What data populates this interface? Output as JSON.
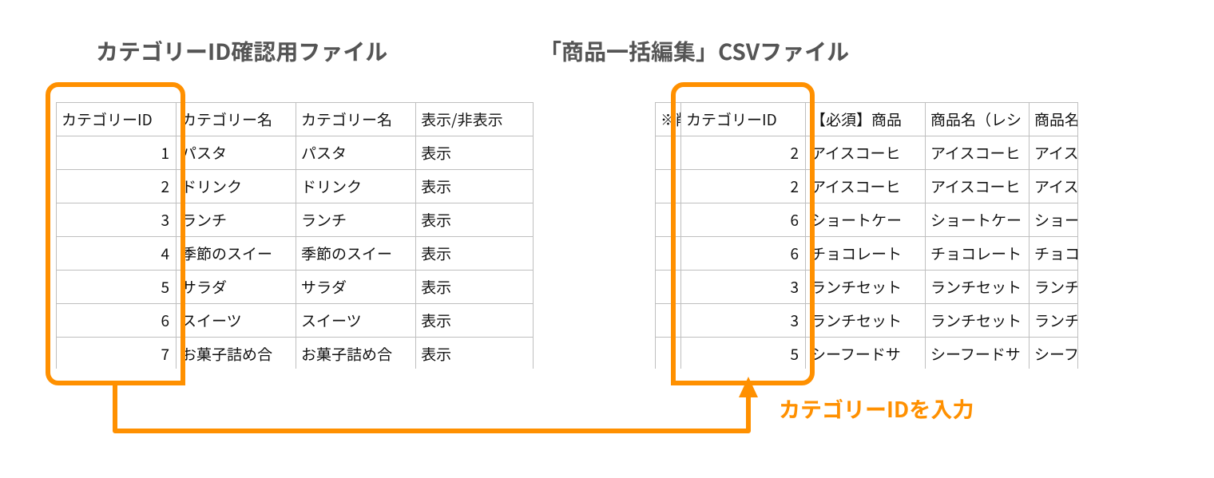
{
  "left_title": "カテゴリーID確認用ファイル",
  "right_title": "「商品一括編集」CSVファイル",
  "callout": "カテゴリーIDを入力",
  "left_table": {
    "headers": [
      "カテゴリーID",
      "カテゴリー名",
      "カテゴリー名",
      "表示/非表示"
    ],
    "rows": [
      {
        "id": "1",
        "name1": "パスタ",
        "name2": "パスタ",
        "vis": "表示"
      },
      {
        "id": "2",
        "name1": "ドリンク",
        "name2": "ドリンク",
        "vis": "表示"
      },
      {
        "id": "3",
        "name1": "ランチ",
        "name2": "ランチ",
        "vis": "表示"
      },
      {
        "id": "4",
        "name1": "季節のスイー",
        "name2": "季節のスイー",
        "vis": "表示"
      },
      {
        "id": "5",
        "name1": "サラダ",
        "name2": "サラダ",
        "vis": "表示"
      },
      {
        "id": "6",
        "name1": "スイーツ",
        "name2": "スイーツ",
        "vis": "表示"
      },
      {
        "id": "7",
        "name1": "お菓子詰め合",
        "name2": "お菓子詰め合",
        "vis": "表示"
      }
    ]
  },
  "right_table": {
    "headers": [
      "※削",
      "カテゴリーID",
      "【必須】商品",
      "商品名（レシ",
      "商品名（商品"
    ],
    "rows": [
      {
        "c0": "",
        "id": "2",
        "p1": "アイスコーヒ",
        "p2": "アイスコーヒ",
        "p3": "アイスコーヒ"
      },
      {
        "c0": "",
        "id": "2",
        "p1": "アイスコーヒ",
        "p2": "アイスコーヒ",
        "p3": "アイスコーヒ"
      },
      {
        "c0": "",
        "id": "6",
        "p1": "ショートケー",
        "p2": "ショートケー",
        "p3": "ショートケー"
      },
      {
        "c0": "",
        "id": "6",
        "p1": "チョコレート",
        "p2": "チョコレート",
        "p3": "チョコレート"
      },
      {
        "c0": "",
        "id": "3",
        "p1": "ランチセット",
        "p2": "ランチセット",
        "p3": "ランチセット"
      },
      {
        "c0": "",
        "id": "3",
        "p1": "ランチセット",
        "p2": "ランチセット",
        "p3": "ランチセット"
      },
      {
        "c0": "",
        "id": "5",
        "p1": "シーフードサ",
        "p2": "シーフードサ",
        "p3": "シーフードサ"
      }
    ]
  }
}
